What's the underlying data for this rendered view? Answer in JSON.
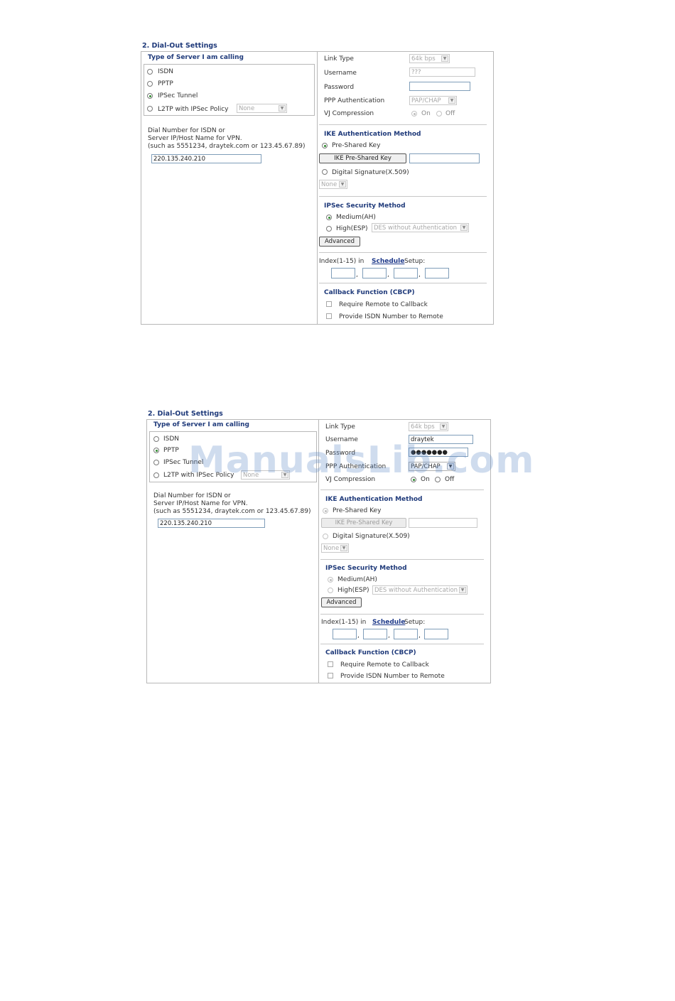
{
  "panels": [
    {
      "section_title": "2. Dial-Out Settings",
      "server_type_title": "Type of Server I am calling",
      "server_options": [
        {
          "label": "ISDN",
          "selected": false
        },
        {
          "label": "PPTP",
          "selected": false
        },
        {
          "label": "IPSec Tunnel",
          "selected": true
        },
        {
          "label": "L2TP with IPSec Policy",
          "selected": false
        }
      ],
      "l2tp_policy_value": "None",
      "dial_label_lines": [
        "Dial Number for ISDN or",
        "Server IP/Host Name for VPN.",
        "(such as 5551234, draytek.com or 123.45.67.89)"
      ],
      "dial_value": "220.135.240.210",
      "link_type_label": "Link Type",
      "link_type_value": "64k bps",
      "username_label": "Username",
      "username_value": "???",
      "password_label": "Password",
      "password_value": "",
      "ppp_auth_label": "PPP Authentication",
      "ppp_auth_value": "PAP/CHAP",
      "vj_label": "VJ Compression",
      "vj_on": "On",
      "vj_off": "Off",
      "ike_title": "IKE Authentication Method",
      "pre_shared_label": "Pre-Shared Key",
      "ike_button": "IKE Pre-Shared Key",
      "digital_sig_label": "Digital Signature(X.509)",
      "digital_sig_value": "None",
      "ipsec_title": "IPSec Security Method",
      "medium_label": "Medium(AH)",
      "high_label": "High(ESP)",
      "high_value": "DES without Authentication",
      "advanced_button": "Advanced",
      "index_prefix": "Index(1-15) in",
      "schedule_link": "Schedule",
      "index_suffix": "Setup:",
      "comma": ",",
      "callback_title": "Callback Function (CBCP)",
      "callback_opt1": "Require Remote to Callback",
      "callback_opt2": "Provide ISDN Number to Remote"
    },
    {
      "section_title": "2. Dial-Out Settings",
      "server_type_title": "Type of Server I am calling",
      "server_options": [
        {
          "label": "ISDN",
          "selected": false
        },
        {
          "label": "PPTP",
          "selected": true
        },
        {
          "label": "IPSec Tunnel",
          "selected": false
        },
        {
          "label": "L2TP with IPSec Policy",
          "selected": false
        }
      ],
      "l2tp_policy_value": "None",
      "dial_label_lines": [
        "Dial Number for ISDN or",
        "Server IP/Host Name for VPN.",
        "(such as 5551234, draytek.com or 123.45.67.89)"
      ],
      "dial_value": "220.135.240.210",
      "link_type_label": "Link Type",
      "link_type_value": "64k bps",
      "username_label": "Username",
      "username_value": "draytek",
      "password_label": "Password",
      "password_value": "●●●●●●●",
      "ppp_auth_label": "PPP Authentication",
      "ppp_auth_value": "PAP/CHAP",
      "vj_label": "VJ Compression",
      "vj_on": "On",
      "vj_off": "Off",
      "ike_title": "IKE Authentication Method",
      "pre_shared_label": "Pre-Shared Key",
      "ike_button": "IKE Pre-Shared Key",
      "digital_sig_label": "Digital Signature(X.509)",
      "digital_sig_value": "None",
      "ipsec_title": "IPSec Security Method",
      "medium_label": "Medium(AH)",
      "high_label": "High(ESP)",
      "high_value": "DES without Authentication",
      "advanced_button": "Advanced",
      "index_prefix": "Index(1-15) in",
      "schedule_link": "Schedule",
      "index_suffix": "Setup:",
      "comma": ",",
      "callback_title": "Callback Function (CBCP)",
      "callback_opt1": "Require Remote to Callback",
      "callback_opt2": "Provide ISDN Number to Remote"
    }
  ],
  "watermark": "ManualsLib.com",
  "colors": {
    "title": "#1f3a7a",
    "radio_selected": "#2f8a2f",
    "border": "#b8b8b8"
  },
  "icons": {
    "select_arrow": "chevron-down-icon",
    "radio": "radio-icon",
    "checkbox": "checkbox-icon"
  }
}
